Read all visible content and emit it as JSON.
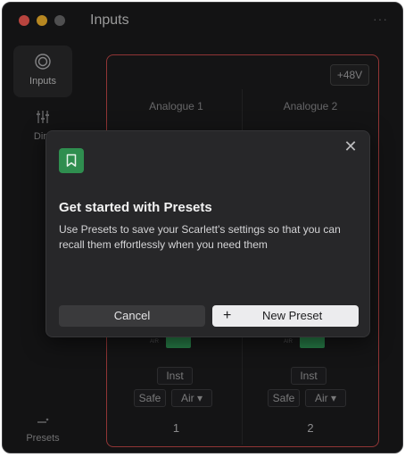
{
  "window": {
    "title": "Inputs",
    "more_glyph": "···"
  },
  "sidebar": {
    "items": [
      {
        "label": "Inputs",
        "icon": "inputs-icon",
        "active": true
      },
      {
        "label": "Dire",
        "icon": "sliders-icon",
        "active": false
      },
      {
        "label": "Presets",
        "icon": "presets-icon",
        "active": false
      }
    ]
  },
  "panel": {
    "phantom_label": "+48V",
    "channels": [
      {
        "name": "Analogue 1",
        "meter_label": "AIR",
        "inst_label": "Inst",
        "safe_label": "Safe",
        "air_label": "Air ▾",
        "number": "1"
      },
      {
        "name": "Analogue 2",
        "meter_label": "AIR",
        "inst_label": "Inst",
        "safe_label": "Safe",
        "air_label": "Air ▾",
        "number": "2"
      }
    ]
  },
  "dialog": {
    "title": "Get started with Presets",
    "body": "Use Presets to save your Scarlett's settings so that you can recall them effortlessly when you need them",
    "close_glyph": "✕",
    "cancel_label": "Cancel",
    "new_preset_plus": "+",
    "new_preset_label": "New Preset",
    "icon": "bookmark-icon"
  },
  "colors": {
    "accent_green": "#2f8e4f",
    "panel_border_red": "#c94a4a",
    "background": "#1b1b1d"
  }
}
